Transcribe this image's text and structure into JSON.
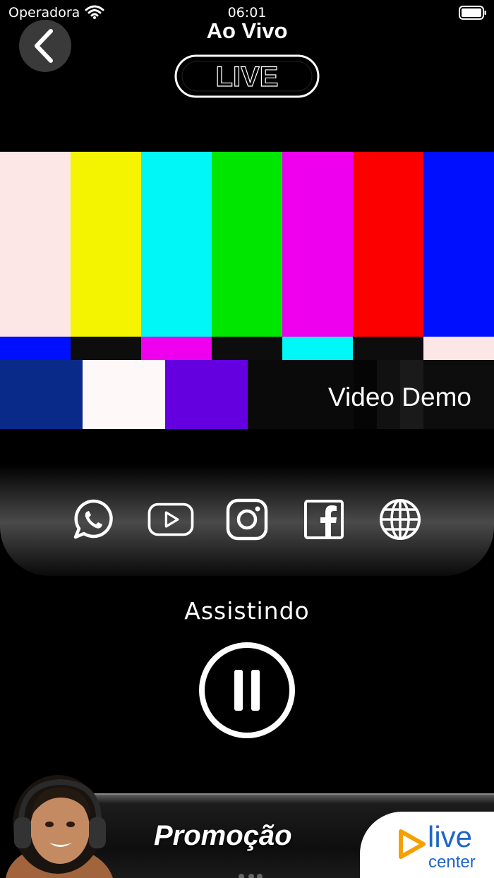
{
  "status_bar": {
    "carrier": "Operadora",
    "time": "06:01"
  },
  "header": {
    "title": "Ao Vivo",
    "badge": "LIVE"
  },
  "video": {
    "caption": "Video Demo"
  },
  "social": [
    {
      "icon": "whatsapp-icon"
    },
    {
      "icon": "youtube-icon"
    },
    {
      "icon": "instagram-icon"
    },
    {
      "icon": "facebook-icon"
    },
    {
      "icon": "globe-icon"
    }
  ],
  "player": {
    "status": "Assistindo",
    "state": "playing"
  },
  "promo": {
    "text": "Promoção",
    "brand_line1": "live",
    "brand_line2": "center"
  },
  "colors": {
    "background": "#000000",
    "panel": "#4a4a4a",
    "brand": "#1f66c9",
    "brand_accent": "#f5a000"
  }
}
